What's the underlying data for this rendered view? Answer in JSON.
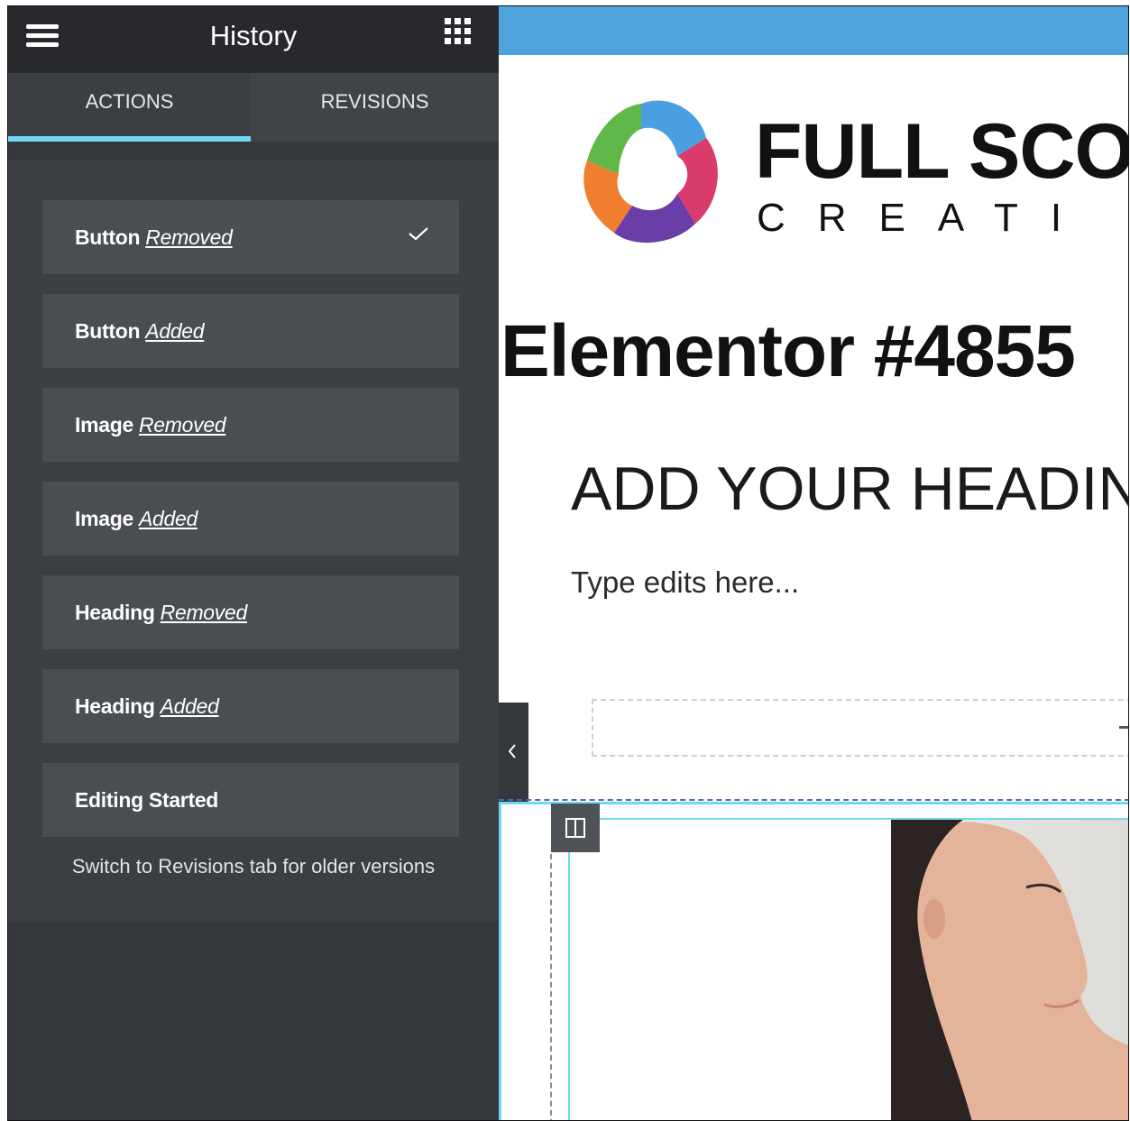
{
  "panel": {
    "title": "History",
    "tabs": [
      {
        "label": "ACTIONS",
        "active": true
      },
      {
        "label": "REVISIONS",
        "active": false
      }
    ],
    "items": [
      {
        "element": "Button",
        "action": "Removed",
        "current": true
      },
      {
        "element": "Button",
        "action": "Added",
        "current": false
      },
      {
        "element": "Image",
        "action": "Removed",
        "current": false
      },
      {
        "element": "Image",
        "action": "Added",
        "current": false
      },
      {
        "element": "Heading",
        "action": "Removed",
        "current": false
      },
      {
        "element": "Heading",
        "action": "Added",
        "current": false
      },
      {
        "element": "Editing Started",
        "action": "",
        "current": false
      }
    ],
    "note": "Switch to Revisions tab for older versions"
  },
  "canvas": {
    "logo_line1": "FULL SCO",
    "logo_line2": "CREATI",
    "page_title": "Elementor #4855",
    "heading": "ADD YOUR HEADIN",
    "text": "Type edits here..."
  },
  "colors": {
    "panel_bg": "#34383c",
    "header_bg": "#27292c",
    "item_bg": "#4a4d52",
    "tab_accent": "#71d7f7",
    "topbar": "#4fa3db"
  },
  "icons": {
    "menu": "hamburger-icon",
    "apps": "grid-icon",
    "current": "check-icon",
    "toggle": "chevron-left-icon",
    "column": "column-icon"
  }
}
